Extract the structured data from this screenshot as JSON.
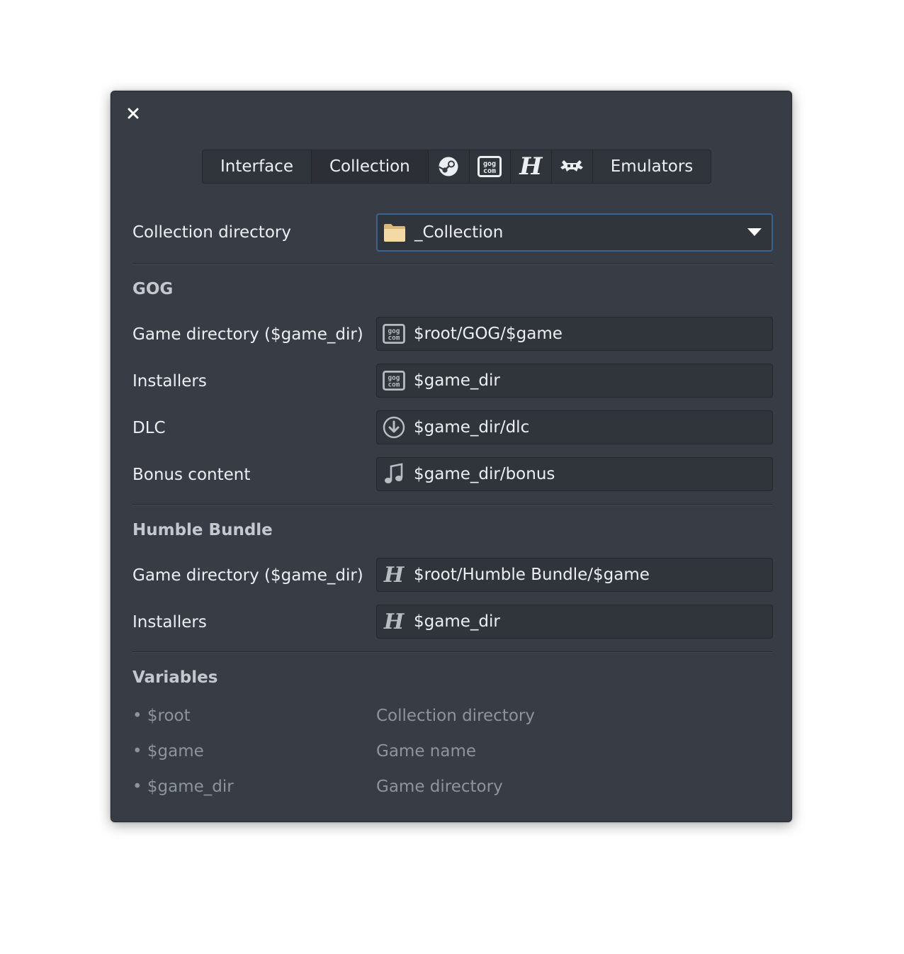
{
  "tabs": [
    {
      "label": "Interface",
      "kind": "text"
    },
    {
      "label": "Collection",
      "kind": "text",
      "active": true
    },
    {
      "icon": "steam-icon",
      "kind": "icon"
    },
    {
      "icon": "gog-icon",
      "kind": "icon"
    },
    {
      "icon": "humble-icon",
      "kind": "icon"
    },
    {
      "icon": "retroarch-icon",
      "kind": "icon"
    },
    {
      "label": "Emulators",
      "kind": "text"
    }
  ],
  "collection": {
    "label": "Collection directory",
    "value": "_Collection",
    "icon": "folder-icon"
  },
  "gog": {
    "title": "GOG",
    "rows": [
      {
        "label": "Game directory ($game_dir)",
        "value": "$root/GOG/$game",
        "icon": "gog-icon"
      },
      {
        "label": "Installers",
        "value": "$game_dir",
        "icon": "gog-icon"
      },
      {
        "label": "DLC",
        "value": "$game_dir/dlc",
        "icon": "download-icon"
      },
      {
        "label": "Bonus content",
        "value": "$game_dir/bonus",
        "icon": "music-note-icon"
      }
    ]
  },
  "humble": {
    "title": "Humble Bundle",
    "rows": [
      {
        "label": "Game directory ($game_dir)",
        "value": "$root/Humble Bundle/$game",
        "icon": "humble-icon"
      },
      {
        "label": "Installers",
        "value": "$game_dir",
        "icon": "humble-icon"
      }
    ]
  },
  "variables": {
    "title": "Variables",
    "items": [
      {
        "name": "• $root",
        "desc": "Collection directory"
      },
      {
        "name": "• $game",
        "desc": "Game name"
      },
      {
        "name": "• $game_dir",
        "desc": "Game directory"
      }
    ]
  },
  "colors": {
    "background": "#383c44",
    "field": "#30343b",
    "focus_border": "#3a6590",
    "text": "#eceff2",
    "muted": "#8e949c"
  }
}
